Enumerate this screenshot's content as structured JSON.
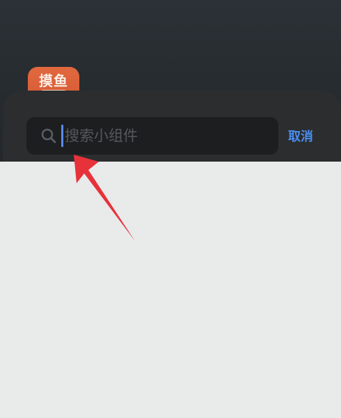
{
  "app_icon": {
    "label": "摸鱼",
    "icon": "fish-app-icon"
  },
  "search": {
    "placeholder": "搜索小组件",
    "value": "",
    "icon": "search-icon"
  },
  "cancel_label": "取消",
  "annotation": {
    "icon": "red-arrow-icon",
    "color": "#e8323a"
  },
  "colors": {
    "accent": "#4a8ef0",
    "caret": "#5a8bf5",
    "sheet": "#2b2d2e",
    "field": "#1d1e20",
    "body": "#e9eaea"
  }
}
